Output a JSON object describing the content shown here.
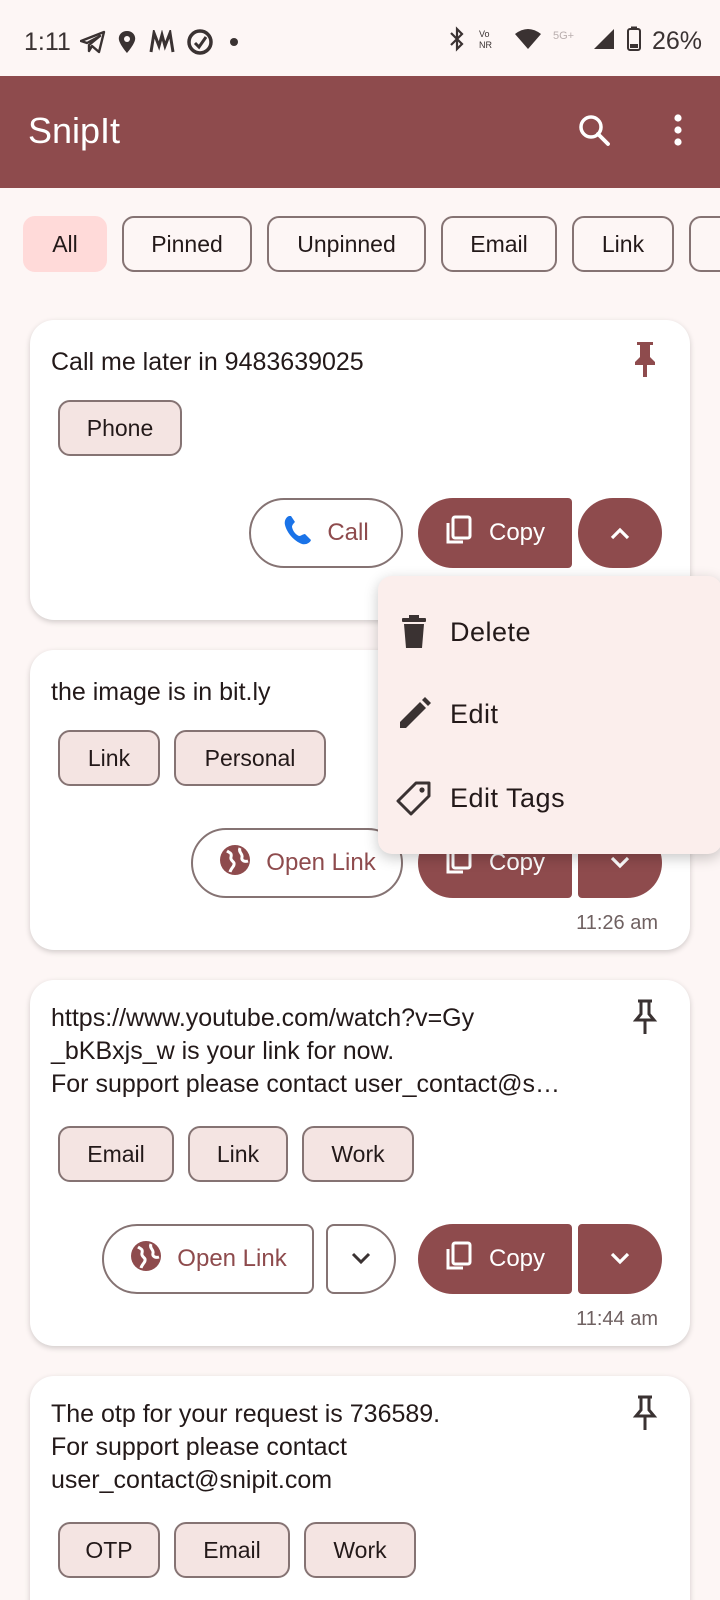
{
  "status": {
    "time": "1:11",
    "battery": "26%"
  },
  "app": {
    "title": "SnipIt"
  },
  "filters": [
    {
      "label": "All",
      "selected": true
    },
    {
      "label": "Pinned",
      "selected": false
    },
    {
      "label": "Unpinned",
      "selected": false
    },
    {
      "label": "Email",
      "selected": false
    },
    {
      "label": "Link",
      "selected": false
    }
  ],
  "cards": [
    {
      "text": "Call me later in 9483639025",
      "tags": [
        "Phone"
      ],
      "action_label": "Call",
      "copy_label": "Copy",
      "pinned": true
    },
    {
      "text": "the image is in bit.ly",
      "tags": [
        "Link",
        "Personal"
      ],
      "action_label": "Open Link",
      "copy_label": "Copy",
      "timestamp": "11:26 am"
    },
    {
      "text": "https://www.youtube.com/watch?v=Gy\n_bKBxjs_w is your link for now.\nFor support please contact user_contact@s…",
      "tags": [
        "Email",
        "Link",
        "Work"
      ],
      "action_label": "Open Link",
      "copy_label": "Copy",
      "timestamp": "11:44 am"
    },
    {
      "text": "The otp for your request is 736589.\nFor support please contact\nuser_contact@snipit.com",
      "tags": [
        "OTP",
        "Email",
        "Work"
      ]
    }
  ],
  "menu": {
    "items": [
      {
        "label": "Delete",
        "icon": "delete-icon"
      },
      {
        "label": "Edit",
        "icon": "pencil-icon"
      },
      {
        "label": "Edit Tags",
        "icon": "tag-icon"
      }
    ]
  }
}
